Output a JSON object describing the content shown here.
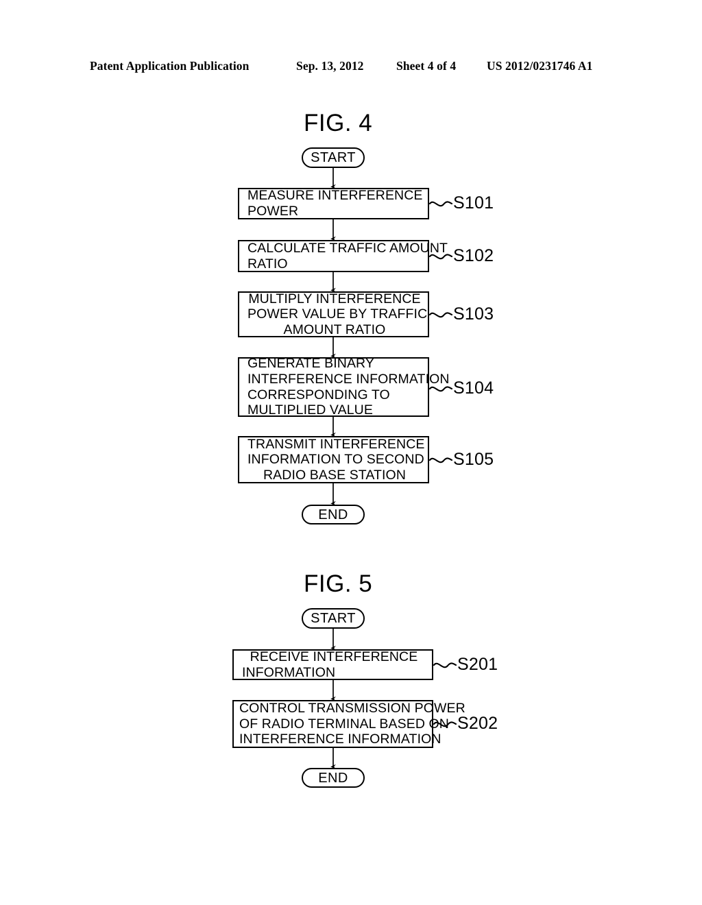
{
  "header": {
    "publication": "Patent Application Publication",
    "date": "Sep. 13, 2012",
    "sheet": "Sheet 4 of 4",
    "number": "US 2012/0231746 A1"
  },
  "figures": [
    {
      "title": "FIG. 4",
      "start_label": "START",
      "end_label": "END",
      "steps": [
        {
          "ref": "S101",
          "align": "firstcenter",
          "lines": [
            "MEASURE INTERFERENCE",
            "POWER"
          ]
        },
        {
          "ref": "S102",
          "align": "firstcenter",
          "lines": [
            "CALCULATE TRAFFIC AMOUNT",
            "RATIO"
          ]
        },
        {
          "ref": "S103",
          "align": "center",
          "lines": [
            "MULTIPLY INTERFERENCE",
            "POWER VALUE BY TRAFFIC",
            "AMOUNT RATIO"
          ]
        },
        {
          "ref": "S104",
          "align": "left",
          "lines": [
            "GENERATE BINARY",
            "INTERFERENCE INFORMATION",
            "CORRESPONDING TO",
            "MULTIPLIED VALUE"
          ]
        },
        {
          "ref": "S105",
          "align": "center",
          "lines": [
            "TRANSMIT INTERFERENCE",
            "INFORMATION TO SECOND",
            "RADIO BASE STATION"
          ]
        }
      ]
    },
    {
      "title": "FIG. 5",
      "start_label": "START",
      "end_label": "END",
      "steps": [
        {
          "ref": "S201",
          "align": "firstcenter",
          "lines": [
            "RECEIVE INTERFERENCE",
            "INFORMATION"
          ]
        },
        {
          "ref": "S202",
          "align": "left",
          "lines": [
            "CONTROL TRANSMISSION POWER",
            "OF RADIO TERMINAL BASED ON",
            "INTERFERENCE INFORMATION"
          ]
        }
      ]
    }
  ],
  "colors": {
    "ink": "#000000",
    "paper": "#ffffff"
  }
}
